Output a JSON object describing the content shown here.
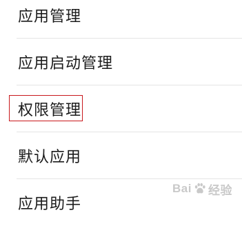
{
  "settings_list": {
    "items": [
      {
        "label": "应用管理"
      },
      {
        "label": "应用启动管理"
      },
      {
        "label": "权限管理"
      },
      {
        "label": "默认应用"
      },
      {
        "label": "应用助手"
      }
    ]
  },
  "highlight": {
    "color": "#c8171b"
  },
  "watermark": {
    "text_left": "Bai",
    "text_right": "经验",
    "logo_icon": "paw-print-icon"
  }
}
